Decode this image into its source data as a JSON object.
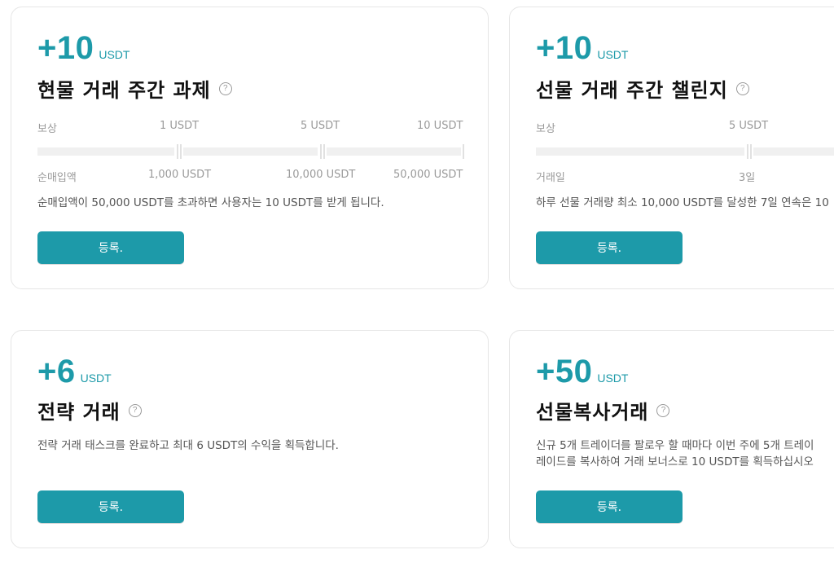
{
  "cards": [
    {
      "amount": "+10",
      "unit": "USDT",
      "title": "현물 거래 주간 과제",
      "reward_label": "보상",
      "reward_values": [
        "1 USDT",
        "5 USDT",
        "10 USDT"
      ],
      "condition_label": "순매입액",
      "condition_values": [
        "1,000 USDT",
        "10,000 USDT",
        "50,000 USDT"
      ],
      "description": "순매입액이 50,000 USDT를 초과하면 사용자는 10 USDT를 받게 됩니다.",
      "button": "등록."
    },
    {
      "amount": "+10",
      "unit": "USDT",
      "title": "선물 거래 주간 챌린지",
      "reward_label": "보상",
      "reward_values": [
        "5 USDT"
      ],
      "condition_label": "거래일",
      "condition_values": [
        "3일"
      ],
      "description": "하루 선물 거래량 최소 10,000 USDT를 달성한 7일 연속은 10",
      "button": "등록."
    },
    {
      "amount": "+6",
      "unit": "USDT",
      "title": "전략 거래",
      "description": "전략 거래 태스크를 완료하고 최대 6 USDT의 수익을 획득합니다.",
      "button": "등록."
    },
    {
      "amount": "+50",
      "unit": "USDT",
      "title": "선물복사거래",
      "description_lines": [
        "신규 5개 트레이더를 팔로우 할 때마다 이번 주에 5개 트레이",
        "레이드를 복사하여 거래 보너스로 10 USDT를 획득하십시오"
      ],
      "button": "등록."
    }
  ],
  "colors": {
    "accent": "#1d9aa9",
    "muted": "#9a9a9a",
    "bar_track": "#f0f0f0"
  },
  "icons": {
    "help": "question-circle-icon"
  }
}
